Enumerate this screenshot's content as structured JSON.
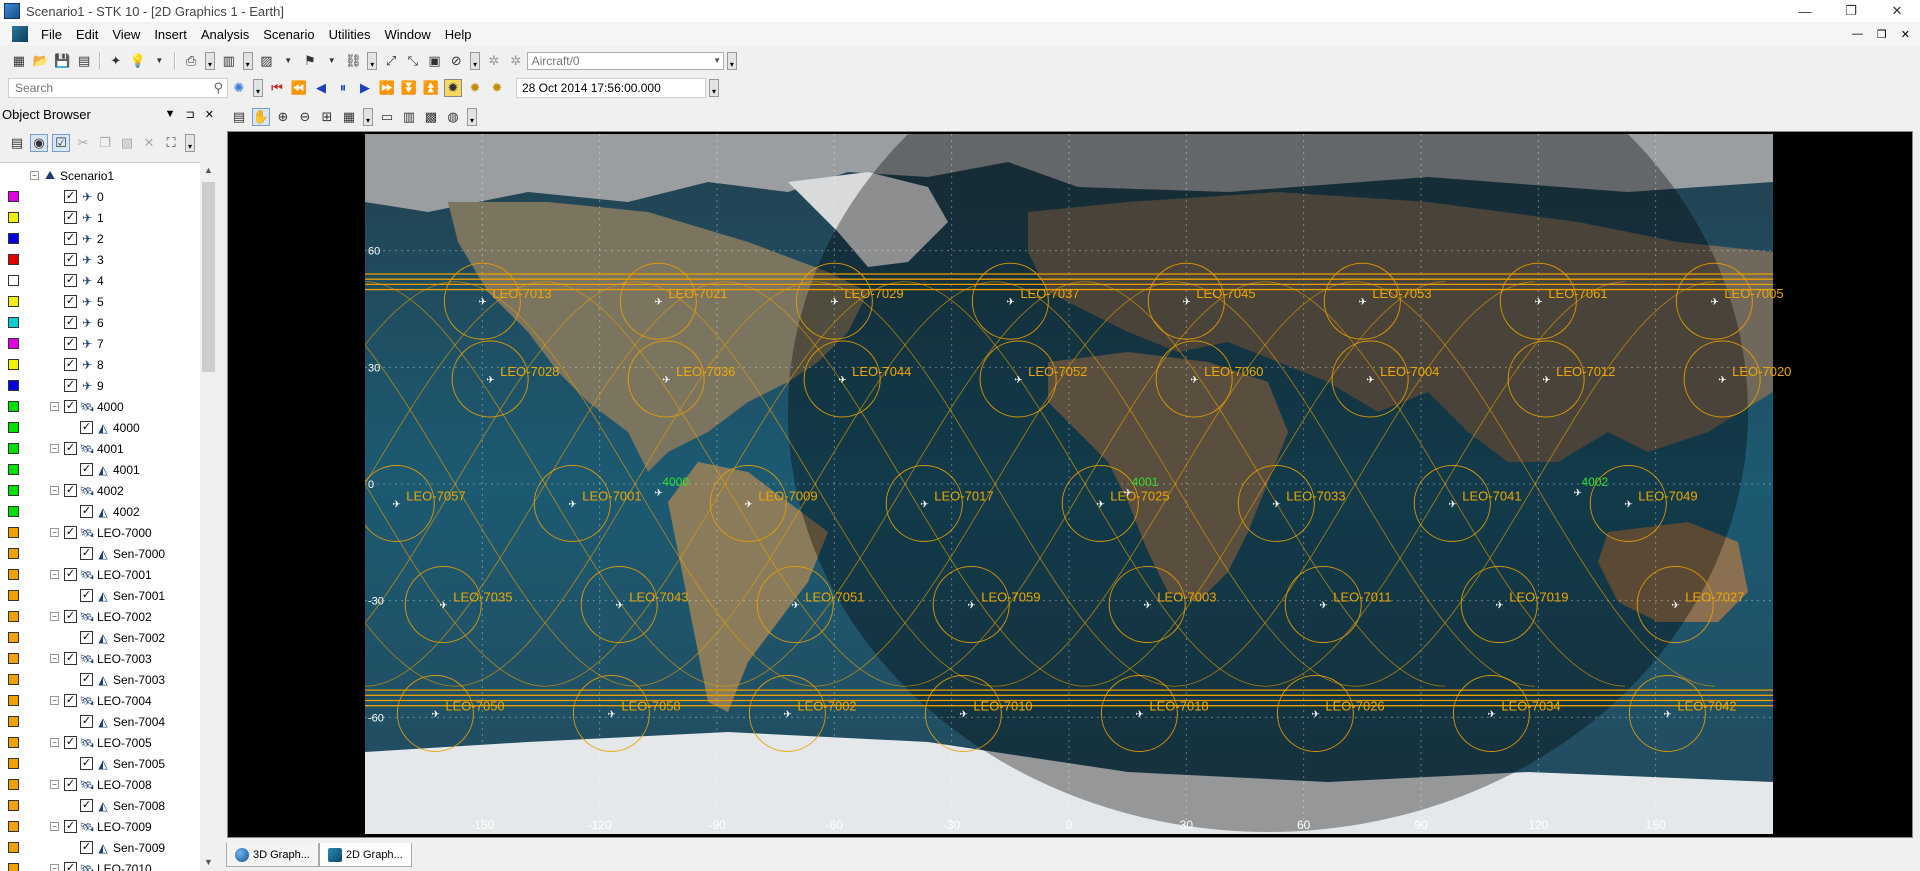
{
  "window": {
    "title": "Scenario1 - STK 10 - [2D Graphics 1 - Earth]",
    "controls": [
      "—",
      "❐",
      "✕"
    ]
  },
  "menu": {
    "items": [
      "File",
      "Edit",
      "View",
      "Insert",
      "Analysis",
      "Scenario",
      "Utilities",
      "Window",
      "Help"
    ],
    "mdi_controls": [
      "—",
      "❐",
      "✕"
    ]
  },
  "toolbar": {
    "object_combo": "Aircraft/0",
    "search_placeholder": "Search",
    "current_time": "28 Oct 2014 17:56:00.000"
  },
  "object_browser": {
    "title": "Object Browser",
    "items": [
      {
        "level": 0,
        "label": "Scenario1",
        "color": "",
        "expand": "minus",
        "icon": "scenario"
      },
      {
        "level": 1,
        "label": "0",
        "color": "#e000e0",
        "expand": "",
        "icon": "aircraft"
      },
      {
        "level": 1,
        "label": "1",
        "color": "#f0f000",
        "expand": "",
        "icon": "aircraft"
      },
      {
        "level": 1,
        "label": "2",
        "color": "#0000e0",
        "expand": "",
        "icon": "aircraft"
      },
      {
        "level": 1,
        "label": "3",
        "color": "#e00000",
        "expand": "",
        "icon": "aircraft"
      },
      {
        "level": 1,
        "label": "4",
        "color": "#ffffff",
        "expand": "",
        "icon": "aircraft"
      },
      {
        "level": 1,
        "label": "5",
        "color": "#f0f000",
        "expand": "",
        "icon": "aircraft"
      },
      {
        "level": 1,
        "label": "6",
        "color": "#00d0d0",
        "expand": "",
        "icon": "aircraft"
      },
      {
        "level": 1,
        "label": "7",
        "color": "#e000e0",
        "expand": "",
        "icon": "aircraft"
      },
      {
        "level": 1,
        "label": "8",
        "color": "#f0f000",
        "expand": "",
        "icon": "aircraft"
      },
      {
        "level": 1,
        "label": "9",
        "color": "#0000e0",
        "expand": "",
        "icon": "aircraft"
      },
      {
        "level": 1,
        "label": "4000",
        "color": "#00e000",
        "expand": "minus",
        "icon": "satellite"
      },
      {
        "level": 2,
        "label": "4000",
        "color": "#00e000",
        "expand": "",
        "icon": "sensor"
      },
      {
        "level": 1,
        "label": "4001",
        "color": "#00e000",
        "expand": "minus",
        "icon": "satellite"
      },
      {
        "level": 2,
        "label": "4001",
        "color": "#00e000",
        "expand": "",
        "icon": "sensor"
      },
      {
        "level": 1,
        "label": "4002",
        "color": "#00e000",
        "expand": "minus",
        "icon": "satellite"
      },
      {
        "level": 2,
        "label": "4002",
        "color": "#00e000",
        "expand": "",
        "icon": "sensor"
      },
      {
        "level": 1,
        "label": "LEO-7000",
        "color": "#f0a000",
        "expand": "minus",
        "icon": "satellite"
      },
      {
        "level": 2,
        "label": "Sen-7000",
        "color": "#f0a000",
        "expand": "",
        "icon": "sensor"
      },
      {
        "level": 1,
        "label": "LEO-7001",
        "color": "#f0a000",
        "expand": "minus",
        "icon": "satellite"
      },
      {
        "level": 2,
        "label": "Sen-7001",
        "color": "#f0a000",
        "expand": "",
        "icon": "sensor"
      },
      {
        "level": 1,
        "label": "LEO-7002",
        "color": "#f0a000",
        "expand": "minus",
        "icon": "satellite"
      },
      {
        "level": 2,
        "label": "Sen-7002",
        "color": "#f0a000",
        "expand": "",
        "icon": "sensor"
      },
      {
        "level": 1,
        "label": "LEO-7003",
        "color": "#f0a000",
        "expand": "minus",
        "icon": "satellite"
      },
      {
        "level": 2,
        "label": "Sen-7003",
        "color": "#f0a000",
        "expand": "",
        "icon": "sensor"
      },
      {
        "level": 1,
        "label": "LEO-7004",
        "color": "#f0a000",
        "expand": "minus",
        "icon": "satellite"
      },
      {
        "level": 2,
        "label": "Sen-7004",
        "color": "#f0a000",
        "expand": "",
        "icon": "sensor"
      },
      {
        "level": 1,
        "label": "LEO-7005",
        "color": "#f0a000",
        "expand": "minus",
        "icon": "satellite"
      },
      {
        "level": 2,
        "label": "Sen-7005",
        "color": "#f0a000",
        "expand": "",
        "icon": "sensor"
      },
      {
        "level": 1,
        "label": "LEO-7008",
        "color": "#f0a000",
        "expand": "minus",
        "icon": "satellite"
      },
      {
        "level": 2,
        "label": "Sen-7008",
        "color": "#f0a000",
        "expand": "",
        "icon": "sensor"
      },
      {
        "level": 1,
        "label": "LEO-7009",
        "color": "#f0a000",
        "expand": "minus",
        "icon": "satellite"
      },
      {
        "level": 2,
        "label": "Sen-7009",
        "color": "#f0a000",
        "expand": "",
        "icon": "sensor"
      },
      {
        "level": 1,
        "label": "LEO-7010",
        "color": "#f0a000",
        "expand": "minus",
        "icon": "satellite"
      }
    ]
  },
  "map": {
    "lon_ticks": [
      "-150",
      "-120",
      "-90",
      "-60",
      "-30",
      "0",
      "30",
      "60",
      "90",
      "120",
      "150"
    ],
    "lat_ticks": [
      "60",
      "30",
      "0",
      "-30",
      "-60"
    ],
    "satellites": [
      {
        "name": "LEO-7013",
        "lon": -150,
        "lat": 47
      },
      {
        "name": "LEO-7021",
        "lon": -105,
        "lat": 47
      },
      {
        "name": "LEO-7029",
        "lon": -60,
        "lat": 47
      },
      {
        "name": "LEO-7037",
        "lon": -15,
        "lat": 47
      },
      {
        "name": "LEO-7045",
        "lon": 30,
        "lat": 47
      },
      {
        "name": "LEO-7053",
        "lon": 75,
        "lat": 47
      },
      {
        "name": "LEO-7061",
        "lon": 120,
        "lat": 47
      },
      {
        "name": "LEO-7005",
        "lon": 165,
        "lat": 47
      },
      {
        "name": "LEO-7028",
        "lon": -148,
        "lat": 27
      },
      {
        "name": "LEO-7036",
        "lon": -103,
        "lat": 27
      },
      {
        "name": "LEO-7044",
        "lon": -58,
        "lat": 27
      },
      {
        "name": "LEO-7052",
        "lon": -13,
        "lat": 27
      },
      {
        "name": "LEO-7060",
        "lon": 32,
        "lat": 27
      },
      {
        "name": "LEO-7004",
        "lon": 77,
        "lat": 27
      },
      {
        "name": "LEO-7012",
        "lon": 122,
        "lat": 27
      },
      {
        "name": "LEO-7020",
        "lon": 167,
        "lat": 27
      },
      {
        "name": "LEO-7057",
        "lon": -172,
        "lat": -5
      },
      {
        "name": "LEO-7001",
        "lon": -127,
        "lat": -5
      },
      {
        "name": "LEO-7009",
        "lon": -82,
        "lat": -5
      },
      {
        "name": "LEO-7017",
        "lon": -37,
        "lat": -5
      },
      {
        "name": "LEO-7025",
        "lon": 8,
        "lat": -5
      },
      {
        "name": "LEO-7033",
        "lon": 53,
        "lat": -5
      },
      {
        "name": "LEO-7041",
        "lon": 98,
        "lat": -5
      },
      {
        "name": "LEO-7049",
        "lon": 143,
        "lat": -5
      },
      {
        "name": "LEO-7035",
        "lon": -160,
        "lat": -31
      },
      {
        "name": "LEO-7043",
        "lon": -115,
        "lat": -31
      },
      {
        "name": "LEO-7051",
        "lon": -70,
        "lat": -31
      },
      {
        "name": "LEO-7059",
        "lon": -25,
        "lat": -31
      },
      {
        "name": "LEO-7003",
        "lon": 20,
        "lat": -31
      },
      {
        "name": "LEO-7011",
        "lon": 65,
        "lat": -31
      },
      {
        "name": "LEO-7019",
        "lon": 110,
        "lat": -31
      },
      {
        "name": "LEO-7027",
        "lon": 155,
        "lat": -31
      },
      {
        "name": "LEO-7050",
        "lon": -162,
        "lat": -59
      },
      {
        "name": "LEO-7058",
        "lon": -117,
        "lat": -59
      },
      {
        "name": "LEO-7002",
        "lon": -72,
        "lat": -59
      },
      {
        "name": "LEO-7010",
        "lon": -27,
        "lat": -59
      },
      {
        "name": "LEO-7018",
        "lon": 18,
        "lat": -59
      },
      {
        "name": "LEO-7026",
        "lon": 63,
        "lat": -59
      },
      {
        "name": "LEO-7034",
        "lon": 108,
        "lat": -59
      },
      {
        "name": "LEO-7042",
        "lon": 153,
        "lat": -59
      }
    ],
    "geo_sats": [
      {
        "name": "4000",
        "lon": -105,
        "lat": -2
      },
      {
        "name": "4001",
        "lon": 15,
        "lat": -2
      },
      {
        "name": "4002",
        "lon": 130,
        "lat": -2
      }
    ],
    "colors": {
      "sat_label": "#f0a800",
      "footprint": "#e8a000",
      "geo_label": "#30e030"
    }
  },
  "tabs": [
    {
      "label": "3D Graph...",
      "active": false
    },
    {
      "label": "2D Graph...",
      "active": true
    }
  ]
}
